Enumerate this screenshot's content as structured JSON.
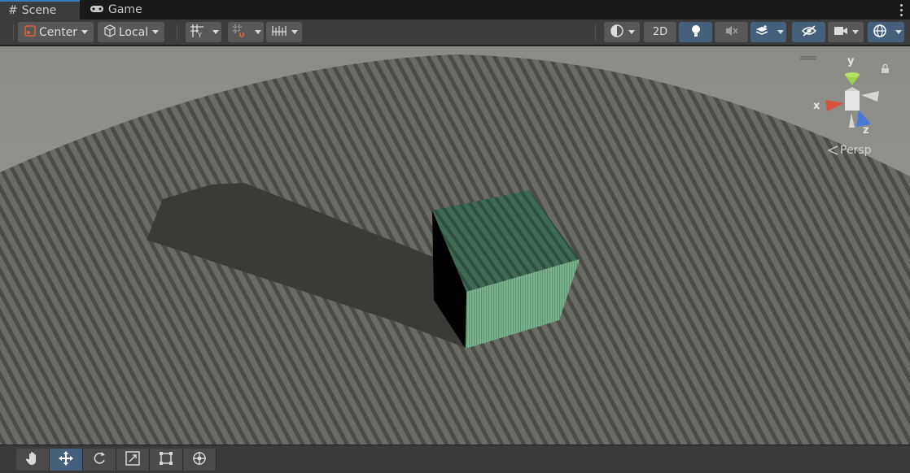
{
  "tabs": [
    {
      "label": "Scene",
      "icon": "hash-icon",
      "active": true
    },
    {
      "label": "Game",
      "icon": "gamepad-icon",
      "active": false
    }
  ],
  "toolbar": {
    "pivot_mode": "Center",
    "pivot_rotation": "Local",
    "btn_2d": "2D"
  },
  "gizmo": {
    "x_label": "x",
    "y_label": "y",
    "z_label": "z",
    "projection": "Persp"
  },
  "colors": {
    "accent": "#46607c",
    "tab_highlight": "#3a79bb",
    "ground": "#6f6f69",
    "cube_top": "#3e6a52",
    "cube_side": "#77ad8a",
    "gizmo_x": "#d5533f",
    "gizmo_y": "#9ed34a",
    "gizmo_z": "#4a78d6"
  },
  "tools": [
    "hand-tool",
    "move-tool",
    "rotate-tool",
    "scale-tool",
    "rect-tool",
    "transform-tool"
  ],
  "active_tool": "move-tool"
}
